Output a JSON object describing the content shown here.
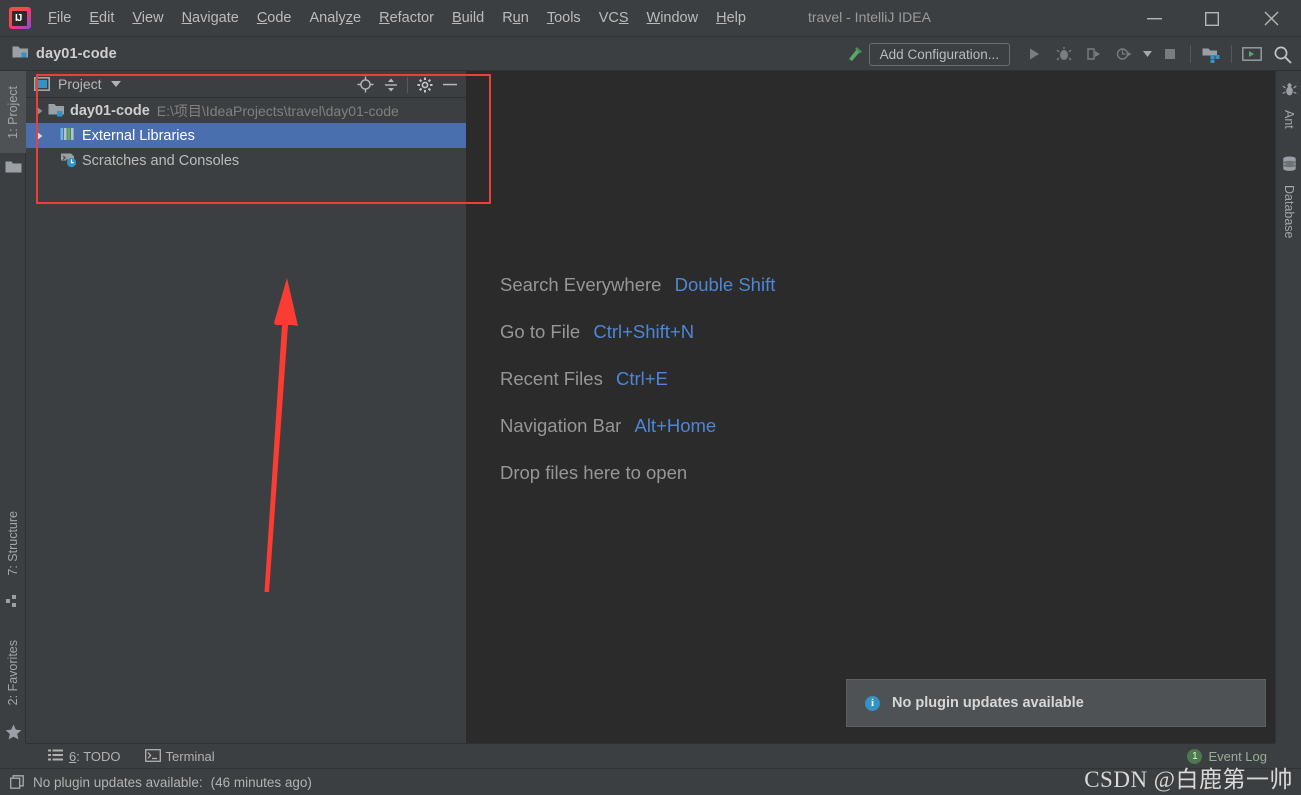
{
  "window": {
    "title": "travel - IntelliJ IDEA",
    "logo_text": "IJ",
    "controls": {
      "minimize": "minimize-icon",
      "maximize": "maximize-icon",
      "close": "close-icon"
    }
  },
  "menubar": {
    "items": [
      {
        "label": "File",
        "mnemonic": "F"
      },
      {
        "label": "Edit",
        "mnemonic": "E"
      },
      {
        "label": "View",
        "mnemonic": "V"
      },
      {
        "label": "Navigate",
        "mnemonic": "N"
      },
      {
        "label": "Code",
        "mnemonic": "C"
      },
      {
        "label": "Analyze",
        "mnemonic": "z"
      },
      {
        "label": "Refactor",
        "mnemonic": "R"
      },
      {
        "label": "Build",
        "mnemonic": "B"
      },
      {
        "label": "Run",
        "mnemonic": "u"
      },
      {
        "label": "Tools",
        "mnemonic": "T"
      },
      {
        "label": "VCS",
        "mnemonic": "S"
      },
      {
        "label": "Window",
        "mnemonic": "W"
      },
      {
        "label": "Help",
        "mnemonic": "H"
      }
    ]
  },
  "toolbar": {
    "breadcrumb": "day01-code",
    "add_configuration_label": "Add Configuration...",
    "icons": [
      "build-hammer-icon",
      "run-icon",
      "debug-icon",
      "run-coverage-icon",
      "profile-icon",
      "dropdown-arrow-icon",
      "stop-icon",
      "project-structure-icon",
      "terminal-window-icon",
      "search-icon"
    ]
  },
  "left_stripe": {
    "items": [
      {
        "label": "1: Project",
        "mnemonic": "1",
        "icon": "folder-icon",
        "active": true
      },
      {
        "label": "7: Structure",
        "mnemonic": "7",
        "icon": "structure-icon",
        "active": false
      },
      {
        "label": "2: Favorites",
        "mnemonic": "2",
        "icon": "star-icon",
        "active": false
      }
    ]
  },
  "right_stripe": {
    "items": [
      {
        "label": "Ant",
        "icon": "ant-bug-icon"
      },
      {
        "label": "Database",
        "icon": "database-icon"
      }
    ]
  },
  "project_panel": {
    "title": "Project",
    "title_icon": "project-window-icon",
    "dropdown_icon": "chevron-down-icon",
    "header_actions": [
      "locate-target-icon",
      "collapse-all-icon",
      "settings-gear-icon",
      "hide-minus-icon"
    ],
    "tree": [
      {
        "label": "day01-code",
        "path": "E:\\项目\\IdeaProjects\\travel\\day01-code",
        "icon": "project-module-icon",
        "expandable": true,
        "expanded": false,
        "selected": false,
        "bold": true,
        "indent": 0
      },
      {
        "label": "External Libraries",
        "path": "",
        "icon": "library-bars-icon",
        "expandable": true,
        "expanded": false,
        "selected": true,
        "bold": false,
        "indent": 1
      },
      {
        "label": "Scratches and Consoles",
        "path": "",
        "icon": "scratches-clock-icon",
        "expandable": false,
        "expanded": false,
        "selected": false,
        "bold": false,
        "indent": 1
      }
    ]
  },
  "editor": {
    "hints": [
      {
        "action": "Search Everywhere",
        "shortcut": "Double Shift"
      },
      {
        "action": "Go to File",
        "shortcut": "Ctrl+Shift+N"
      },
      {
        "action": "Recent Files",
        "shortcut": "Ctrl+E"
      },
      {
        "action": "Navigation Bar",
        "shortcut": "Alt+Home"
      },
      {
        "action": "Drop files here to open",
        "shortcut": ""
      }
    ]
  },
  "notification_balloon": {
    "icon": "info-icon",
    "icon_glyph": "i",
    "message": "No plugin updates available"
  },
  "toolwindow_bar": {
    "buttons": [
      {
        "label": "6: TODO",
        "mnemonic": "6",
        "icon": "todo-list-icon"
      },
      {
        "label": "Terminal",
        "mnemonic": "",
        "icon": "terminal-icon"
      }
    ],
    "event_log": {
      "label": "Event Log",
      "badge_count": "1"
    }
  },
  "statusbar": {
    "icon": "memory-indicator-icon",
    "message": "No plugin updates available:",
    "timestamp": "(46 minutes ago)"
  },
  "watermark": "CSDN @白鹿第一帅",
  "annotations": {
    "highlight_box": {
      "label": "project-tree-highlight",
      "color": "#e8413a"
    },
    "arrow": {
      "label": "pointer-arrow-up",
      "color": "#fa3c32"
    }
  },
  "colors": {
    "panel_bg": "#3c3f41",
    "editor_bg": "#2b2b2b",
    "selection_blue": "#4b6eaf",
    "link_blue": "#4e86d6",
    "accent_red": "#e8413a",
    "text_primary": "#bbbbbb",
    "text_dim": "#808080"
  }
}
